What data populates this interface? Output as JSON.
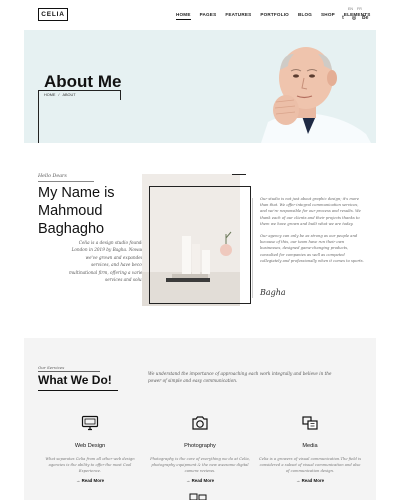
{
  "header": {
    "logo": "CELIA",
    "nav": [
      "HOME",
      "PAGES",
      "FEATURES",
      "PORTFOLIO",
      "BLOG",
      "SHOP",
      "ELEMENTS"
    ],
    "lang": [
      "EN",
      "FR"
    ],
    "socials": [
      {
        "icon": "twitter-icon",
        "glyph": "t"
      },
      {
        "icon": "instagram-icon",
        "glyph": "◎"
      },
      {
        "icon": "behance-icon",
        "glyph": "Be"
      }
    ]
  },
  "hero": {
    "title": "About Me",
    "breadcrumb_home": "HOME",
    "breadcrumb_sep": "/",
    "breadcrumb_current": "ABOUT"
  },
  "about": {
    "eyebrow": "Hello Dears",
    "name": "My Name is Mahmoud Baghagho",
    "intro": "Celia is a design studio founded in London in 2019 by Bagha. Nowadays, we've grown and expanded our services, and have become a multinational firm, offering a variety of services and solutions",
    "para1": "Our studio is not just about graphic design; it's more than that. We offer integral communication services, and we're responsible for our process and results. We thank each of our clients and their projects thanks to them we have grown and built what we are today.",
    "para2": "Our agency can only be as strong as our people and because of this, our team have run their own businesses, designed game-changing products, consulted for companies as well as competed collegiately and professionally when it comes to sports.",
    "signature": "Bagha"
  },
  "services": {
    "eyebrow": "Our Services",
    "title": "What We Do!",
    "description": "We understand the importance of approaching each work integrally and believe in the power of simple and easy communication.",
    "cards": [
      {
        "title": "Web Design",
        "icon": "monitor-icon",
        "text": "What separates Celia from all other web design agencies is the ability to offer the most Cool Experience.",
        "link": "→ Read More"
      },
      {
        "title": "Photography",
        "icon": "camera-icon",
        "text": "Photography is the core of everything we do at Celia, photography equipment & the new awesome digital camera reviews.",
        "link": "→ Read More"
      },
      {
        "title": "Media",
        "icon": "media-icon",
        "text": "Celia is a growers of visual communication.The field is considered a subset of visual communication and also of communication design.",
        "link": "→ Read More"
      }
    ]
  }
}
